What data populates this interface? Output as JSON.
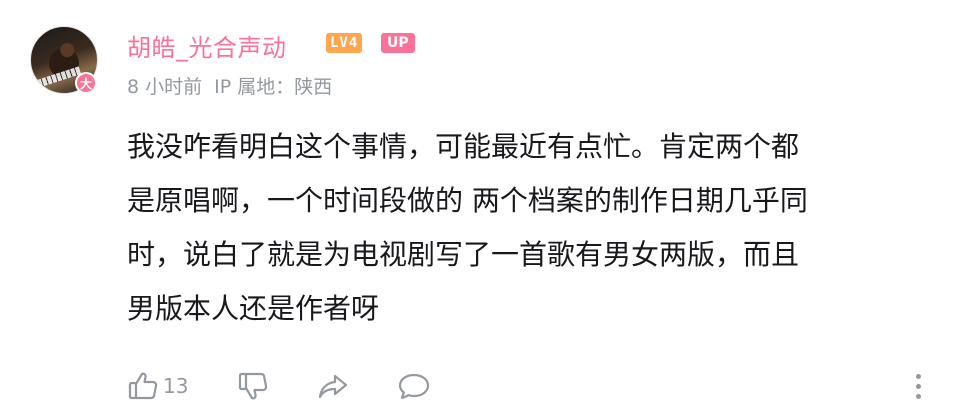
{
  "comment": {
    "user": {
      "name": "胡皓_光合声动",
      "level_badge": "LV4",
      "up_badge": "UP",
      "avatar_badge": "大"
    },
    "meta": {
      "time": "8 小时前",
      "ip_location": "IP 属地：陕西"
    },
    "lines": [
      "我没咋看明白这个事情，可能最近有点忙。肯定两个都",
      "是原唱啊，一个时间段做的 两个档案的制作日期几乎同",
      "时，说白了就是为电视剧写了一首歌有男女两版，而且",
      "男版本人还是作者呀"
    ],
    "actions": {
      "like_count": "13",
      "icons": [
        "thumbs-up-icon",
        "thumbs-down-icon",
        "share-icon",
        "reply-icon",
        "more-vertical-icon"
      ]
    },
    "colors": {
      "username": "#fb7299",
      "level": "#ffa64d",
      "up": "#fb7299",
      "meta": "#9499a0",
      "text": "#18191c"
    }
  }
}
